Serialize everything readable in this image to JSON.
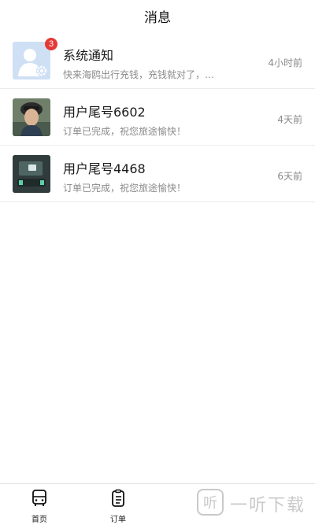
{
  "header": {
    "title": "消息"
  },
  "messages": [
    {
      "name": "系统通知",
      "preview": "快来海鸥出行充钱，充钱就对了，…",
      "time": "4小时前",
      "badge": "3",
      "avatar": "system-avatar"
    },
    {
      "name": "用户尾号6602",
      "preview": "订单已完成，祝您旅途愉快！",
      "time": "4天前",
      "avatar": "user-photo"
    },
    {
      "name": "用户尾号4468",
      "preview": "订单已完成，祝您旅途愉快！",
      "time": "6天前",
      "avatar": "user-photo"
    }
  ],
  "tabbar": {
    "items": [
      {
        "label": "首页",
        "icon": "bus-icon"
      },
      {
        "label": "订单",
        "icon": "order-icon"
      }
    ]
  },
  "watermark": {
    "text": "一听下载"
  },
  "colors": {
    "badge": "#e53935",
    "avatar_bg": "#c9dcf3"
  }
}
